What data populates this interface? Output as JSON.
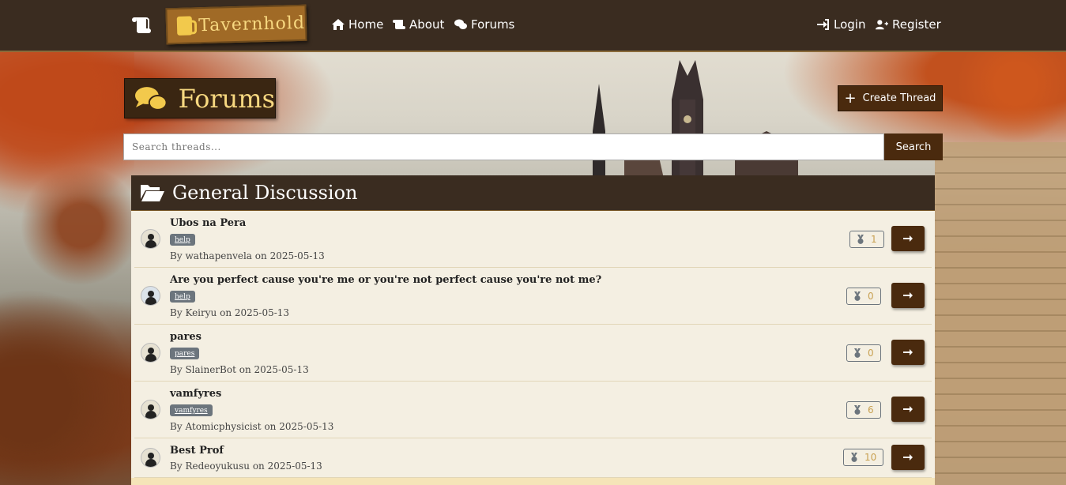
{
  "navbar": {
    "brand_name": "Tavernhold",
    "links": [
      {
        "label": "Home",
        "icon": "home-icon"
      },
      {
        "label": "About",
        "icon": "scroll-icon"
      },
      {
        "label": "Forums",
        "icon": "comments-icon"
      }
    ],
    "login_label": "Login",
    "register_label": "Register"
  },
  "page": {
    "title": "Forums",
    "create_label": "Create Thread",
    "search_placeholder": "Search threads...",
    "search_label": "Search"
  },
  "section": {
    "title": "General Discussion",
    "threads": [
      {
        "title": "Ubos na Pera",
        "tag": "help",
        "by": "By",
        "author": "wathapenvela",
        "on": "on",
        "date": "2025-05-13",
        "count": "1"
      },
      {
        "title": "Are you perfect cause you're me or you're not perfect cause you're not me?",
        "tag": "help",
        "by": "By",
        "author": "Keiryu",
        "on": "on",
        "date": "2025-05-13",
        "count": "0"
      },
      {
        "title": "pares",
        "tag": "pares",
        "by": "By",
        "author": "SlainerBot",
        "on": "on",
        "date": "2025-05-13",
        "count": "0"
      },
      {
        "title": "vamfyres",
        "tag": "vamfyres",
        "by": "By",
        "author": "Atomicphysicist",
        "on": "on",
        "date": "2025-05-13",
        "count": "6"
      },
      {
        "title": "Best Prof",
        "tag": "",
        "by": "By",
        "author": "Redeoyukusu",
        "on": "on",
        "date": "2025-05-13",
        "count": "10"
      }
    ]
  }
}
